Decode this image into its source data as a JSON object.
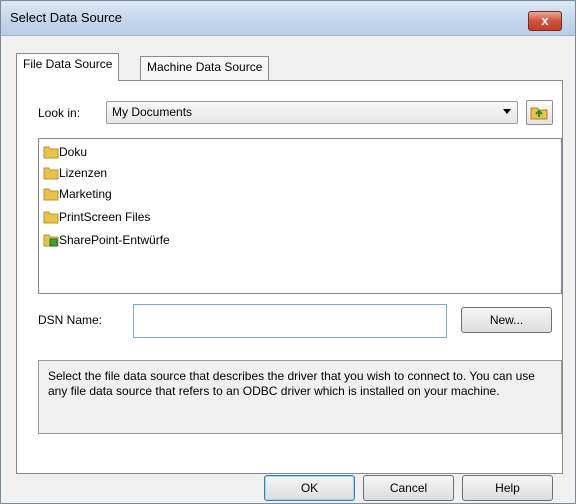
{
  "window": {
    "title": "Select Data Source",
    "close_label": "x"
  },
  "tabs": [
    {
      "label": "File Data Source",
      "active": true
    },
    {
      "label": "Machine Data Source",
      "active": false
    }
  ],
  "look_in": {
    "label": "Look in:",
    "value": "My Documents"
  },
  "files": [
    {
      "name": "Doku",
      "icon": "folder-icon"
    },
    {
      "name": "Lizenzen",
      "icon": "folder-icon"
    },
    {
      "name": "Marketing",
      "icon": "folder-icon"
    },
    {
      "name": "PrintScreen Files",
      "icon": "folder-icon"
    },
    {
      "name": "SharePoint-Entwürfe",
      "icon": "sharepoint-folder-icon"
    }
  ],
  "dsn": {
    "label": "DSN Name:",
    "value": "",
    "new_label": "New..."
  },
  "description": "Select the file data source that describes the driver that you wish to connect to. You can use any file data source that refers to an ODBC driver which is installed on your machine.",
  "buttons": {
    "ok": "OK",
    "cancel": "Cancel",
    "help": "Help"
  },
  "colors": {
    "folder": "#e8c24a",
    "titlebar": "#c5d7ec",
    "close": "#c9462f"
  }
}
